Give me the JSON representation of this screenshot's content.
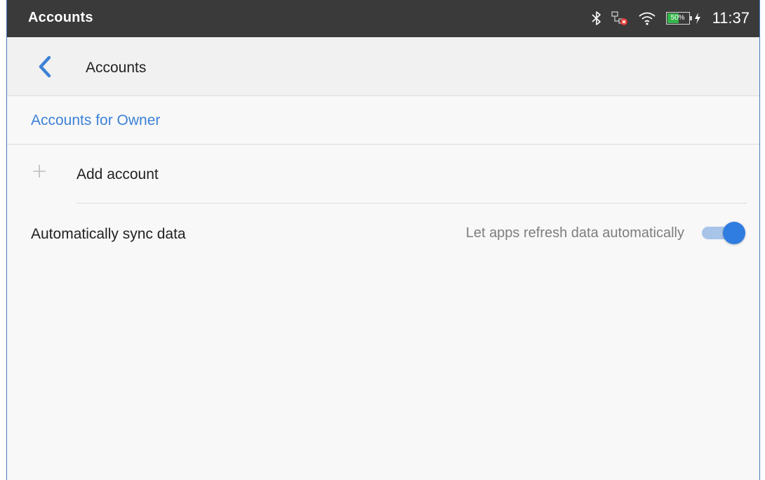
{
  "status_bar": {
    "app_title": "Accounts",
    "time": "11:37",
    "battery_percent": "50%",
    "icons": [
      "bluetooth-icon",
      "ethernet-disconnected-icon",
      "wifi-icon",
      "battery-icon",
      "charging-icon"
    ]
  },
  "toolbar": {
    "title": "Accounts",
    "back_icon": "chevron-left-icon"
  },
  "section": {
    "header": "Accounts for Owner"
  },
  "add_account": {
    "label": "Add account",
    "icon": "plus-icon"
  },
  "sync": {
    "label": "Automatically sync data",
    "summary": "Let apps refresh data automatically",
    "enabled": true
  },
  "colors": {
    "accent": "#3d82d6",
    "status_bar": "#3a3a3a",
    "toggle_thumb": "#2f7de0",
    "toggle_track": "#a8c4e9",
    "battery_fill": "#35b54a",
    "error_badge": "#e53935"
  }
}
